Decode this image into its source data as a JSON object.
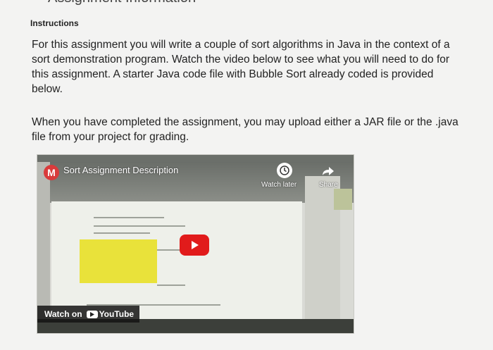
{
  "page": {
    "top_title_fragment": "Assignment Information",
    "heading": "Instructions",
    "paragraph_1": "For this assignment you will write a couple of sort algorithms in Java in the context of a sort demonstration program. Watch the video below to see what you will need to do for this assignment. A starter Java code file with Bubble Sort already coded is provided below.",
    "paragraph_2": "When you have completed the assignment, you may upload either a JAR file or the .java file from your project for grading."
  },
  "video": {
    "channel_initial": "M",
    "title": "Sort Assignment Description",
    "watch_later_label": "Watch later",
    "share_label": "Share",
    "watch_on_label": "Watch on",
    "youtube_label": "YouTube",
    "icons": [
      "clock-icon",
      "share-arrow-icon",
      "play-icon",
      "youtube-logo-icon"
    ],
    "colors": {
      "play": "#e11b1b",
      "avatar": "#d93b3b",
      "highlight": "#e9e23a"
    }
  }
}
